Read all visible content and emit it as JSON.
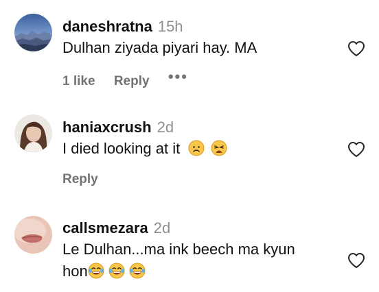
{
  "comments": [
    {
      "username": "daneshratna",
      "time": "15h",
      "text": "Dulhan ziyada piyari hay. MA",
      "likes": "1 like",
      "reply": "Reply",
      "more": "•••",
      "avatar_icon": "mountain-landscape-avatar"
    },
    {
      "username": "haniaxcrush",
      "time": "2d",
      "text": "I died looking at it",
      "emojis": [
        "worried-face-emoji",
        "weary-face-emoji"
      ],
      "reply": "Reply",
      "avatar_icon": "woman-portrait-avatar"
    },
    {
      "username": "callsmezara",
      "time": "2d",
      "text_line1": "Le Dulhan...ma ink beech ma kyun",
      "text_line2": "hon",
      "emojis": [
        "tears-of-joy-emoji",
        "tears-of-joy-emoji",
        "tears-of-joy-emoji"
      ],
      "avatar_icon": "lips-closeup-avatar"
    }
  ],
  "colors": {
    "text": "#111111",
    "muted": "#8e8e8e",
    "meta": "#737373"
  }
}
